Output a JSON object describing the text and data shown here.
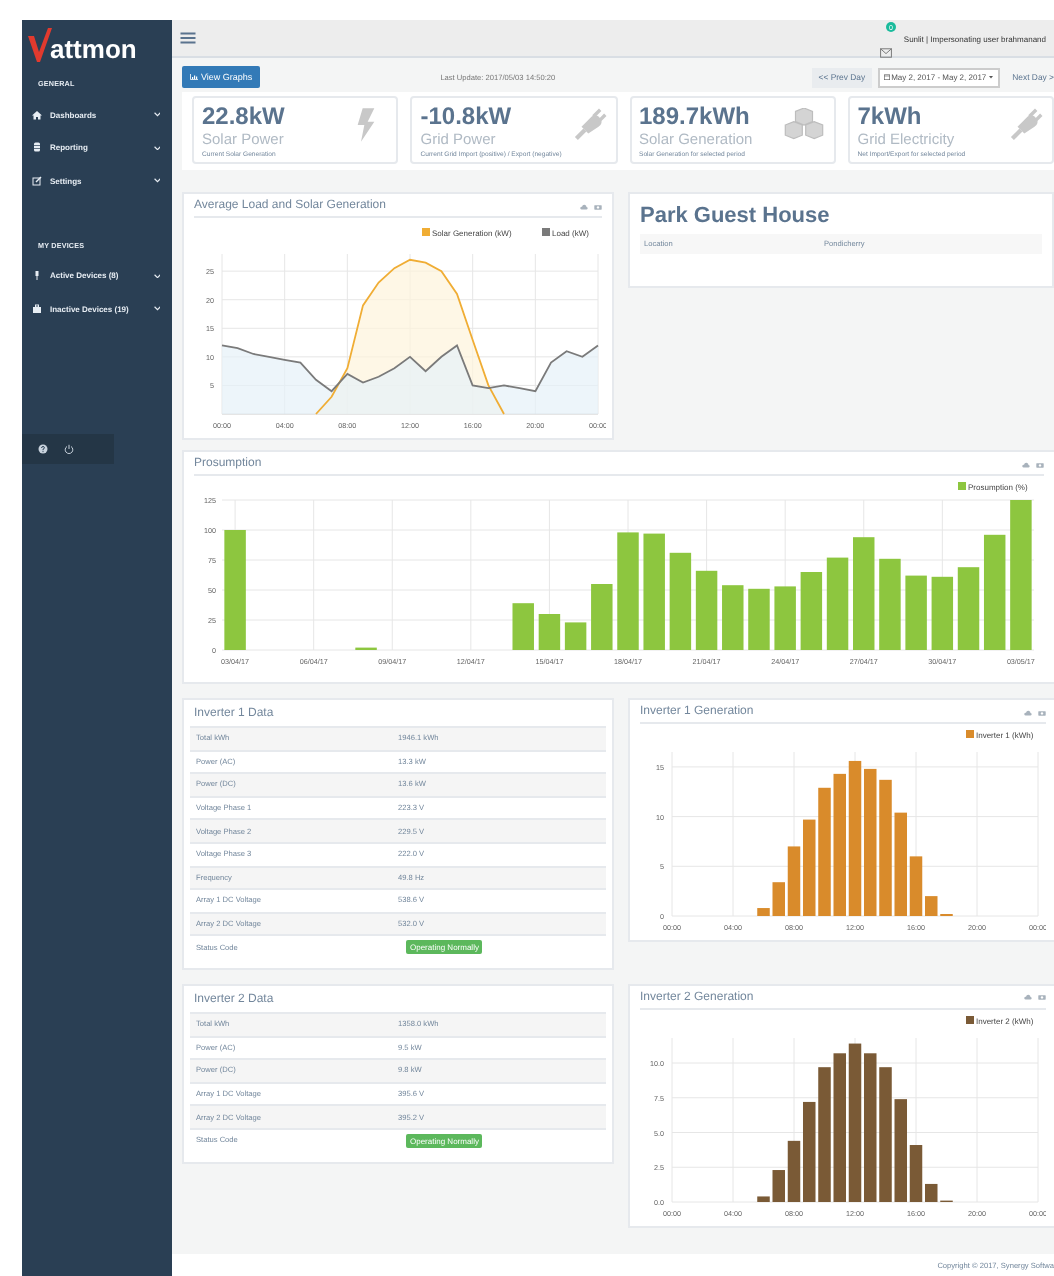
{
  "brand": {
    "name": "attmon"
  },
  "sidebar": {
    "sections": [
      {
        "heading": "GENERAL",
        "items": [
          {
            "label": "Dashboards",
            "kind": "home"
          },
          {
            "label": "Reporting",
            "kind": "database"
          },
          {
            "label": "Settings",
            "kind": "edit"
          }
        ]
      },
      {
        "heading": "MY DEVICES",
        "items": [
          {
            "label": "Active Devices (8)",
            "kind": "pin"
          },
          {
            "label": "Inactive Devices (19)",
            "kind": "box"
          }
        ]
      }
    ]
  },
  "header": {
    "notification_count": "0",
    "user": "Sunlit | Impersonating user brahmanand"
  },
  "toolbar": {
    "view_graphs": "View Graphs",
    "last_update": "Last Update: 2017/05/03 14:50:20",
    "prev_day": "<< Prev Day",
    "date_range": "May 2, 2017 - May 2, 2017",
    "next_day": "Next Day >"
  },
  "stats": [
    {
      "value": "22.8kW",
      "label": "Solar Power",
      "note": "Current Solar Generation",
      "kind": "bolt"
    },
    {
      "value": "-10.8kW",
      "label": "Grid Power",
      "note": "Current Grid Import (positive) / Export (negative)",
      "kind": "plug"
    },
    {
      "value": "189.7kWh",
      "label": "Solar Generation",
      "note": "Solar Generation for selected period",
      "kind": "cubes"
    },
    {
      "value": "7kWh",
      "label": "Grid Electricity",
      "note": "Net Import/Export for selected period",
      "kind": "plug"
    }
  ],
  "load_chart": {
    "title": "Average Load and Solar Generation",
    "chart_data": {
      "type": "area",
      "grid": true,
      "legend": "top-right",
      "x": [
        0,
        1,
        2,
        3,
        4,
        5,
        6,
        7,
        8,
        9,
        10,
        11,
        12,
        13,
        14,
        15,
        16,
        17,
        18,
        19,
        20,
        21,
        22,
        23,
        24
      ],
      "xlim": [
        0,
        24
      ],
      "ylim": [
        0,
        28
      ],
      "xticks": [
        {
          "value": 0,
          "label": "00:00"
        },
        {
          "value": 4,
          "label": "04:00"
        },
        {
          "value": 8,
          "label": "08:00"
        },
        {
          "value": 12,
          "label": "12:00"
        },
        {
          "value": 16,
          "label": "16:00"
        },
        {
          "value": 20,
          "label": "20:00"
        },
        {
          "value": 24,
          "label": "00:00"
        }
      ],
      "yticks": [
        5,
        10,
        15,
        20,
        25
      ],
      "series": [
        {
          "name": "Solar Generation (kW)",
          "color": "#f0ad34",
          "values": [
            null,
            null,
            null,
            null,
            null,
            null,
            0,
            3,
            8,
            19,
            23,
            25.5,
            27,
            26.5,
            25,
            21,
            13,
            5,
            0,
            null,
            null,
            null,
            null,
            null,
            null
          ]
        },
        {
          "name": "Load (kW)",
          "color": "#7a7a7a",
          "values": [
            12,
            11.5,
            10.5,
            10,
            9.5,
            9,
            6,
            4,
            7,
            5.5,
            6.5,
            8,
            10,
            7.5,
            10,
            12,
            5,
            4.5,
            5,
            4.5,
            4,
            9,
            11,
            10,
            12
          ]
        }
      ]
    }
  },
  "site": {
    "name": "Park Guest House",
    "fields": [
      {
        "label": "Location",
        "value": "Pondicherry"
      }
    ]
  },
  "prosumption": {
    "title": "Prosumption",
    "chart_data": {
      "type": "bar",
      "grid": true,
      "legend": "top-right",
      "categories": [
        "03/04/17",
        null,
        null,
        "06/04/17",
        null,
        null,
        "09/04/17",
        null,
        null,
        "12/04/17",
        null,
        null,
        "15/04/17",
        null,
        null,
        "18/04/17",
        null,
        null,
        "21/04/17",
        null,
        null,
        "24/04/17",
        null,
        null,
        "27/04/17",
        null,
        null,
        "30/04/17",
        null,
        null,
        "03/05/17"
      ],
      "ylim": [
        0,
        125
      ],
      "yticks": [
        0,
        25,
        50,
        75,
        100,
        125
      ],
      "series": [
        {
          "name": "Prosumption (%)",
          "color": "#8dc63f",
          "values": [
            100,
            0,
            0,
            0,
            0,
            2,
            0,
            0,
            0,
            0,
            0,
            39,
            30,
            23,
            55,
            98,
            97,
            81,
            66,
            54,
            51,
            53,
            65,
            77,
            94,
            76,
            62,
            61,
            69,
            96,
            125
          ]
        }
      ]
    }
  },
  "inverters": [
    {
      "title": "Inverter 1 Data",
      "rows": [
        {
          "label": "Total kWh",
          "value": "1946.1 kWh",
          "kind": "text"
        },
        {
          "label": "Power (AC)",
          "value": "13.3 kW",
          "kind": "text"
        },
        {
          "label": "Power (DC)",
          "value": "13.6 kW",
          "kind": "text"
        },
        {
          "label": "Voltage Phase 1",
          "value": "223.3 V",
          "kind": "text"
        },
        {
          "label": "Voltage Phase 2",
          "value": "229.5 V",
          "kind": "text"
        },
        {
          "label": "Voltage Phase 3",
          "value": "222.0 V",
          "kind": "text"
        },
        {
          "label": "Frequency",
          "value": "49.8 Hz",
          "kind": "text"
        },
        {
          "label": "Array 1 DC Voltage",
          "value": "538.6 V",
          "kind": "text"
        },
        {
          "label": "Array 2 DC Voltage",
          "value": "532.0 V",
          "kind": "text"
        },
        {
          "label": "Status Code",
          "value": "Operating Normally",
          "kind": "badge"
        }
      ],
      "generation": {
        "title": "Inverter 1 Generation",
        "chart_data": {
          "type": "bar",
          "grid": true,
          "legend": "top-right",
          "x": [
            6,
            7,
            8,
            9,
            10,
            11,
            12,
            13,
            14,
            15,
            16,
            17,
            18
          ],
          "xlim": [
            0,
            24
          ],
          "ylim": [
            0,
            16.5
          ],
          "xticks": [
            {
              "value": 0,
              "label": "00:00"
            },
            {
              "value": 4,
              "label": "04:00"
            },
            {
              "value": 8,
              "label": "08:00"
            },
            {
              "value": 12,
              "label": "12:00"
            },
            {
              "value": 16,
              "label": "16:00"
            },
            {
              "value": 20,
              "label": "20:00"
            },
            {
              "value": 24,
              "label": "00:00"
            }
          ],
          "yticks": [
            0,
            5,
            10,
            15
          ],
          "series": [
            {
              "name": "Inverter 1 (kWh)",
              "color": "#d98b2b",
              "values": [
                0.8,
                3.4,
                7,
                9.7,
                12.9,
                14.3,
                15.6,
                14.8,
                13.7,
                10.4,
                6,
                2,
                0.2
              ]
            }
          ]
        }
      }
    },
    {
      "title": "Inverter 2 Data",
      "rows": [
        {
          "label": "Total kWh",
          "value": "1358.0 kWh",
          "kind": "text"
        },
        {
          "label": "Power (AC)",
          "value": "9.5 kW",
          "kind": "text"
        },
        {
          "label": "Power (DC)",
          "value": "9.8 kW",
          "kind": "text"
        },
        {
          "label": "Array 1 DC Voltage",
          "value": "395.6 V",
          "kind": "text"
        },
        {
          "label": "Array 2 DC Voltage",
          "value": "395.2 V",
          "kind": "text"
        },
        {
          "label": "Status Code",
          "value": "Operating Normally",
          "kind": "badge"
        }
      ],
      "generation": {
        "title": "Inverter 2 Generation",
        "chart_data": {
          "type": "bar",
          "grid": true,
          "legend": "top-right",
          "x": [
            6,
            7,
            8,
            9,
            10,
            11,
            12,
            13,
            14,
            15,
            16,
            17,
            18
          ],
          "xlim": [
            0,
            24
          ],
          "ylim": [
            0,
            11.8
          ],
          "xticks": [
            {
              "value": 0,
              "label": "00:00"
            },
            {
              "value": 4,
              "label": "04:00"
            },
            {
              "value": 8,
              "label": "08:00"
            },
            {
              "value": 12,
              "label": "12:00"
            },
            {
              "value": 16,
              "label": "16:00"
            },
            {
              "value": 20,
              "label": "20:00"
            },
            {
              "value": 24,
              "label": "00:00"
            }
          ],
          "yticks": [
            {
              "value": 0,
              "label": "0.0"
            },
            {
              "value": 2.5,
              "label": "2.5"
            },
            {
              "value": 5,
              "label": "5.0"
            },
            {
              "value": 7.5,
              "label": "7.5"
            },
            {
              "value": 10,
              "label": "10.0"
            }
          ],
          "series": [
            {
              "name": "Inverter 2 (kWh)",
              "color": "#7a5a36",
              "values": [
                0.4,
                2.3,
                4.4,
                7.2,
                9.7,
                10.7,
                11.4,
                10.7,
                9.7,
                7.4,
                4.1,
                1.3,
                0.1
              ]
            }
          ]
        }
      }
    }
  ],
  "footer": {
    "copyright": "Copyright © 2017, Synergy Softwa"
  }
}
